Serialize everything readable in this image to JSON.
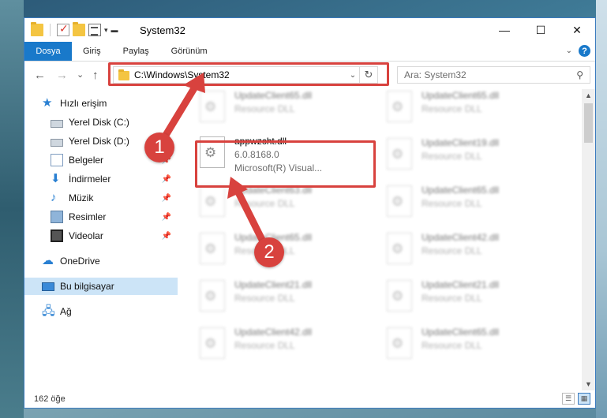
{
  "window": {
    "title": "System32",
    "controls": {
      "minimize": "—",
      "maximize": "☐",
      "close": "✕"
    }
  },
  "ribbon": {
    "tabs": [
      "Dosya",
      "Giriş",
      "Paylaş",
      "Görünüm"
    ],
    "help": "?"
  },
  "navigation": {
    "back": "←",
    "forward": "→",
    "recent": "⌄",
    "up": "↑",
    "address": "C:\\Windows\\System32",
    "refresh": "↻",
    "search_placeholder": "Ara: System32"
  },
  "sidebar": {
    "items": [
      {
        "label": "Hızlı erişim",
        "icon": "star-icon",
        "pinned": false
      },
      {
        "label": "Yerel Disk (C:)",
        "icon": "disk-icon",
        "pinned": false
      },
      {
        "label": "Yerel Disk (D:)",
        "icon": "disk-icon",
        "pinned": false
      },
      {
        "label": "Belgeler",
        "icon": "documents-icon",
        "pinned": true
      },
      {
        "label": "İndirmeler",
        "icon": "downloads-icon",
        "pinned": true
      },
      {
        "label": "Müzik",
        "icon": "music-icon",
        "pinned": true
      },
      {
        "label": "Resimler",
        "icon": "pictures-icon",
        "pinned": true
      },
      {
        "label": "Videolar",
        "icon": "videos-icon",
        "pinned": true
      },
      {
        "label": "OneDrive",
        "icon": "cloud-icon",
        "pinned": false
      },
      {
        "label": "Bu bilgisayar",
        "icon": "computer-icon",
        "pinned": false,
        "selected": true
      },
      {
        "label": "Ağ",
        "icon": "network-icon",
        "pinned": false
      }
    ]
  },
  "files": [
    {
      "name": "UpdateClient65.dll",
      "type": "Resource DLL",
      "blurred": true
    },
    {
      "name": "UpdateClient65.dll",
      "type": "Resource DLL",
      "blurred": true
    },
    {
      "name": "appwzcht.dll",
      "version": "6.0.8168.0",
      "type": "Microsoft(R) Visual...",
      "blurred": false,
      "highlighted": true
    },
    {
      "name": "UpdateClient19.dll",
      "type": "Resource DLL",
      "blurred": true
    },
    {
      "name": "UpdateClient63.dll",
      "type": "Resource DLL",
      "blurred": true
    },
    {
      "name": "UpdateClient65.dll",
      "type": "Resource DLL",
      "blurred": true
    },
    {
      "name": "UpdateClient65.dll",
      "type": "Resource DLL",
      "blurred": true
    },
    {
      "name": "UpdateClient42.dll",
      "type": "Resource DLL",
      "blurred": true
    },
    {
      "name": "UpdateClient21.dll",
      "type": "Resource DLL",
      "blurred": true
    },
    {
      "name": "UpdateClient21.dll",
      "type": "Resource DLL",
      "blurred": true
    },
    {
      "name": "UpdateClient42.dll",
      "type": "Resource DLL",
      "blurred": true
    },
    {
      "name": "UpdateClient65.dll",
      "type": "Resource DLL",
      "blurred": true
    }
  ],
  "status": {
    "item_count": "162 öğe"
  },
  "annotations": {
    "step1": "1",
    "step2": "2",
    "color": "#d8423e"
  }
}
